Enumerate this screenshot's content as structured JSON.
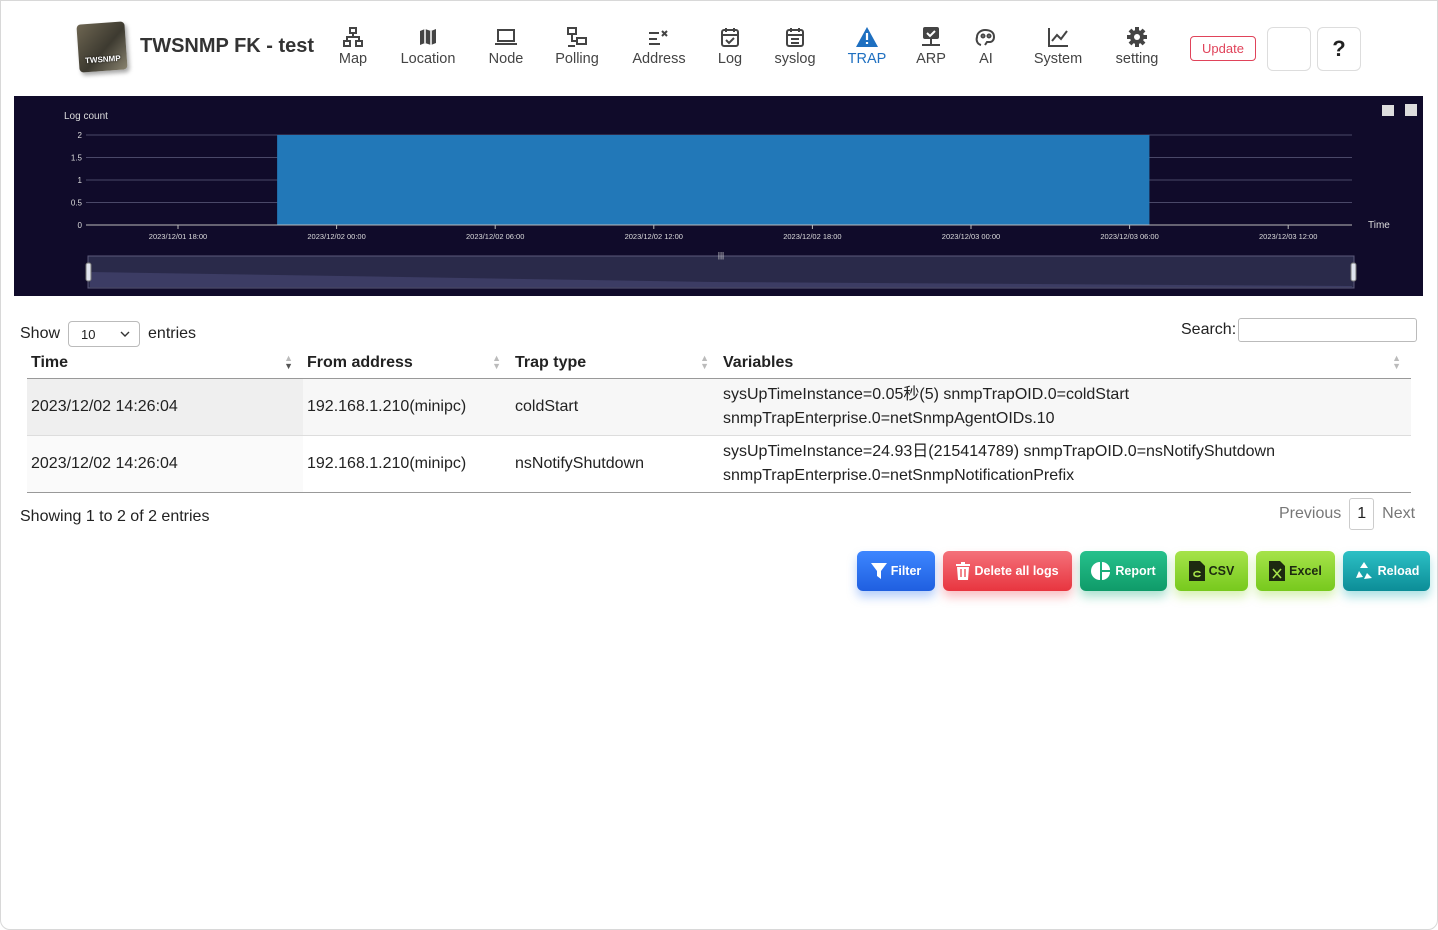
{
  "app": {
    "title": "TWSNMP FK - test",
    "logo_text": "TWSNMP"
  },
  "nav": [
    {
      "label": "Map",
      "icon": "sitemap-icon"
    },
    {
      "label": "Location",
      "icon": "map-icon"
    },
    {
      "label": "Node",
      "icon": "laptop-icon"
    },
    {
      "label": "Polling",
      "icon": "polling-icon"
    },
    {
      "label": "Address",
      "icon": "address-list-icon"
    },
    {
      "label": "Log",
      "icon": "calendar-check-icon"
    },
    {
      "label": "syslog",
      "icon": "calendar-icon"
    },
    {
      "label": "TRAP",
      "icon": "warning-icon",
      "active": true
    },
    {
      "label": "ARP",
      "icon": "arp-icon"
    },
    {
      "label": "AI",
      "icon": "brain-icon"
    },
    {
      "label": "System",
      "icon": "line-chart-icon"
    },
    {
      "label": "setting",
      "icon": "gear-icon"
    }
  ],
  "header_buttons": {
    "update": "Update",
    "theme_icon": "moon-icon",
    "help": "?"
  },
  "chart_data": {
    "type": "bar",
    "ylabel": "Log count",
    "xlabel": "Time",
    "yticks": [
      "0",
      "0.5",
      "1",
      "1.5",
      "2"
    ],
    "ylim": [
      0,
      2
    ],
    "xticks": [
      "2023/12/01 18:00",
      "2023/12/02 00:00",
      "2023/12/02 06:00",
      "2023/12/02 12:00",
      "2023/12/02 18:00",
      "2023/12/03 00:00",
      "2023/12/03 06:00",
      "2023/12/03 12:00"
    ],
    "bars": [
      {
        "start": "2023/12/01 21:45",
        "end": "2023/12/03 06:45",
        "value": 2
      }
    ],
    "colors": {
      "bar": "#2278b8",
      "background": "#100b2a"
    }
  },
  "table": {
    "show_label": "Show",
    "page_size": "10",
    "entries_label": "entries",
    "search_label": "Search:",
    "search_value": "",
    "columns": [
      "Time",
      "From address",
      "Trap type",
      "Variables"
    ],
    "rows": [
      {
        "time": "2023/12/02 14:26:04",
        "from": "192.168.1.210(minipc)",
        "type": "coldStart",
        "vars1": "sysUpTimeInstance=0.05秒(5) snmpTrapOID.0=coldStart",
        "vars2": "snmpTrapEnterprise.0=netSnmpAgentOIDs.10"
      },
      {
        "time": "2023/12/02 14:26:04",
        "from": "192.168.1.210(minipc)",
        "type": "nsNotifyShutdown",
        "vars1": "sysUpTimeInstance=24.93日(215414789) snmpTrapOID.0=nsNotifyShutdown",
        "vars2": "snmpTrapEnterprise.0=netSnmpNotificationPrefix"
      }
    ],
    "info": "Showing 1 to 2 of 2 entries",
    "pager": {
      "previous": "Previous",
      "page": "1",
      "next": "Next"
    }
  },
  "actions": [
    {
      "label": "Filter",
      "icon": "filter-icon",
      "color": "#2b73f0"
    },
    {
      "label": "Delete all logs",
      "icon": "trash-icon",
      "color": "#ee4a55"
    },
    {
      "label": "Report",
      "icon": "pie-chart-icon",
      "color": "#14a877"
    },
    {
      "label": "CSV",
      "icon": "csv-file-icon",
      "color": "#8bd82a"
    },
    {
      "label": "Excel",
      "icon": "excel-file-icon",
      "color": "#8bd82a"
    },
    {
      "label": "Reload",
      "icon": "recycle-icon",
      "color": "#12a9b0"
    }
  ]
}
